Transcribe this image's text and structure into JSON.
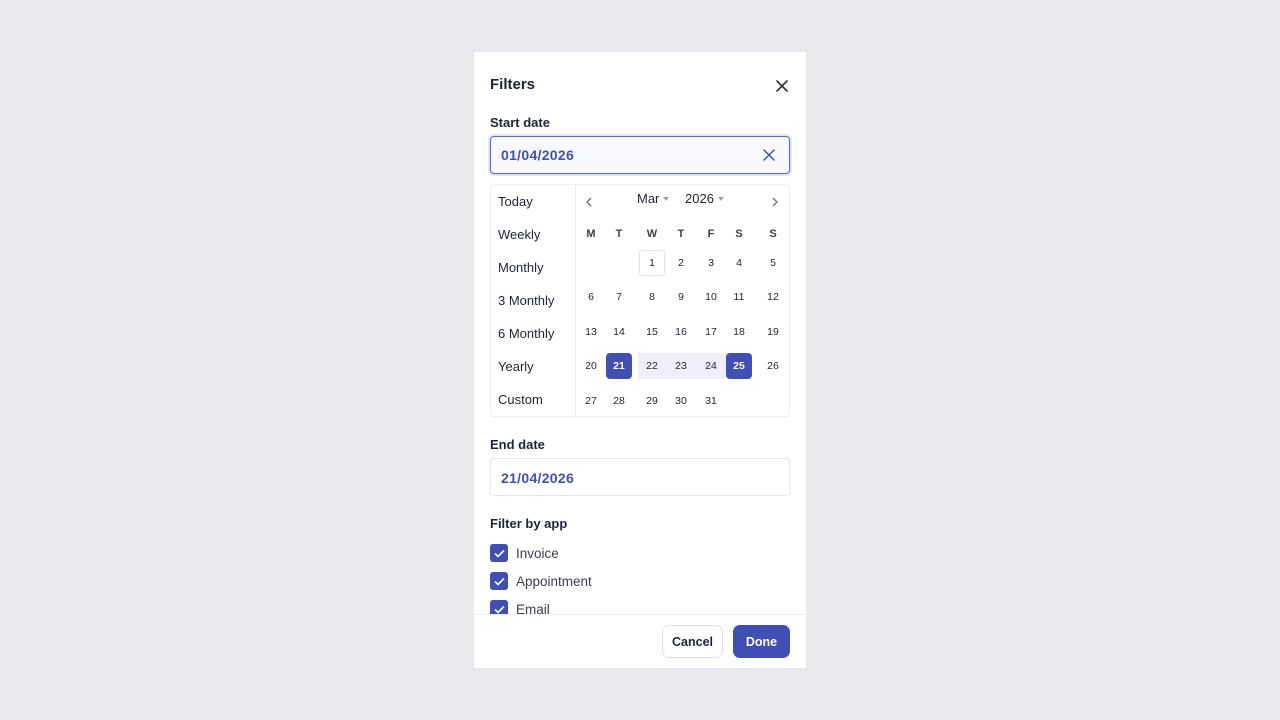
{
  "dialog": {
    "title": "Filters",
    "close_icon": "close-icon"
  },
  "start_date": {
    "label": "Start date",
    "value": "01/04/2026",
    "clear_icon": "close-icon"
  },
  "date_picker": {
    "presets": [
      "Today",
      "Weekly",
      "Monthly",
      "3 Monthly",
      "6 Monthly",
      "Yearly",
      "Custom"
    ],
    "month": "Mar",
    "year": "2026",
    "weekdays": [
      "M",
      "T",
      "W",
      "T",
      "F",
      "S",
      "S"
    ],
    "weeks": [
      [
        "",
        "",
        "1",
        "2",
        "3",
        "4",
        "5"
      ],
      [
        "6",
        "7",
        "8",
        "9",
        "10",
        "11",
        "12"
      ],
      [
        "13",
        "14",
        "15",
        "16",
        "17",
        "18",
        "19"
      ],
      [
        "20",
        "21",
        "22",
        "23",
        "24",
        "25",
        "26"
      ],
      [
        "27",
        "28",
        "29",
        "30",
        "31",
        "",
        ""
      ]
    ],
    "today": "1",
    "range_start": "21",
    "range_end": "25",
    "accent": "#3f4fb4",
    "range_fill": "#eeeffa"
  },
  "end_date": {
    "label": "End date",
    "value": "21/04/2026"
  },
  "filter_by_app": {
    "label": "Filter by app",
    "options": [
      {
        "label": "Invoice",
        "checked": true
      },
      {
        "label": "Appointment",
        "checked": true
      },
      {
        "label": "Email",
        "checked": true
      }
    ]
  },
  "footer": {
    "cancel_label": "Cancel",
    "done_label": "Done"
  }
}
